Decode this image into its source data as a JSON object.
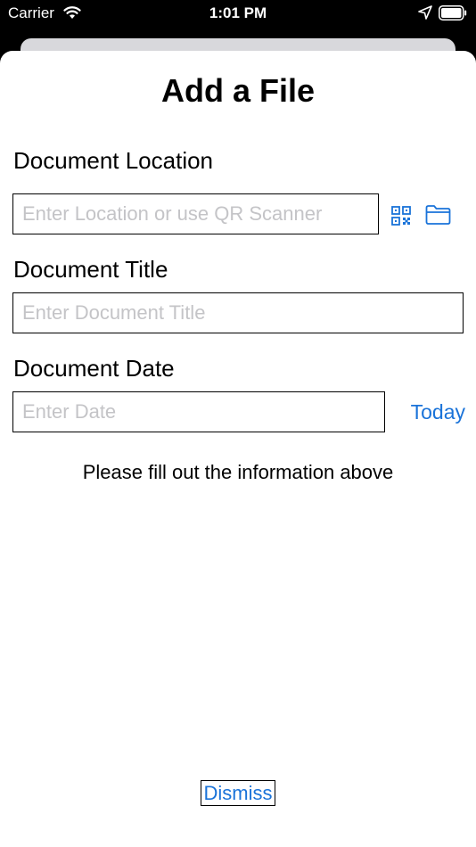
{
  "status_bar": {
    "carrier": "Carrier",
    "time": "1:01 PM",
    "wifi_icon": "wifi-icon",
    "location_icon": "location-arrow-icon",
    "battery_icon": "battery-icon"
  },
  "sheet": {
    "title": "Add a File",
    "document_location": {
      "label": "Document Location",
      "value": "",
      "placeholder": "Enter Location or use QR Scanner",
      "qr_icon": "qr-code-icon",
      "folder_icon": "folder-icon"
    },
    "document_title": {
      "label": "Document Title",
      "value": "",
      "placeholder": "Enter Document Title"
    },
    "document_date": {
      "label": "Document Date",
      "value": "",
      "placeholder": "Enter Date",
      "today_label": "Today"
    },
    "info_message": "Please fill out the information above",
    "dismiss_label": "Dismiss"
  },
  "colors": {
    "accent": "#1a73d9",
    "placeholder": "#c4c4c7",
    "background": "#000000",
    "sheet": "#ffffff"
  }
}
